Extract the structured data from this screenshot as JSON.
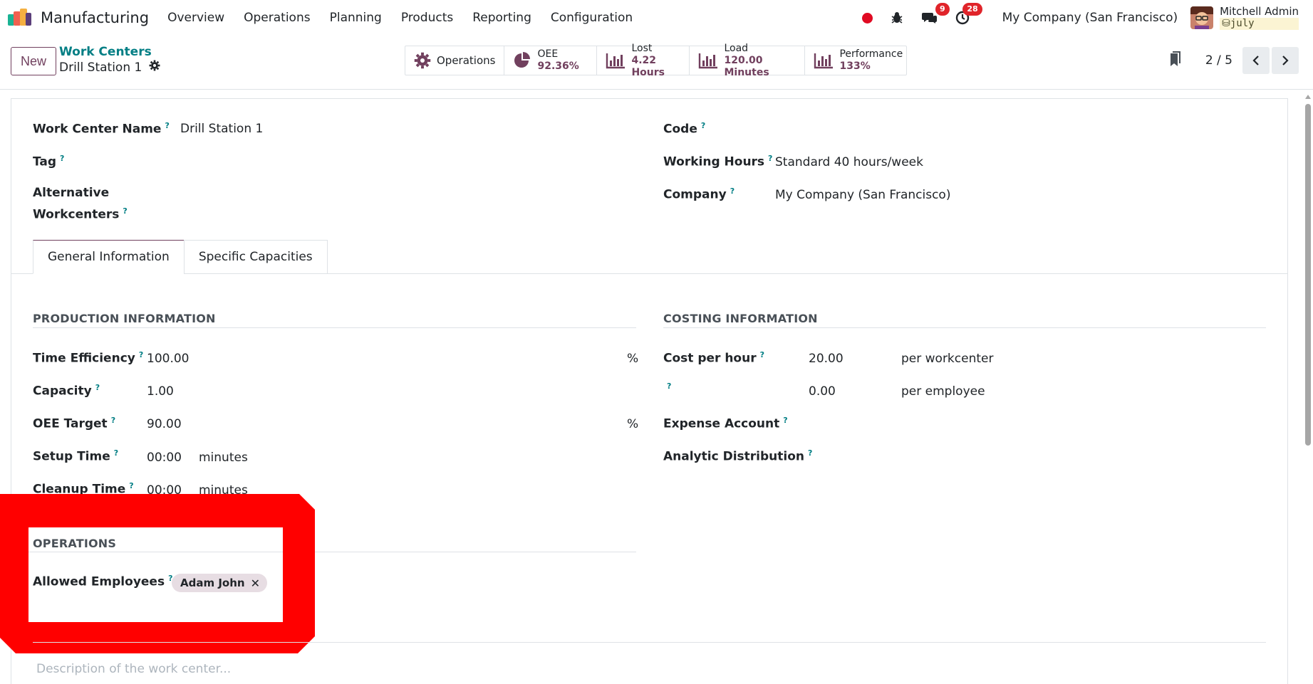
{
  "navbar": {
    "app_name": "Manufacturing",
    "menu": [
      "Overview",
      "Operations",
      "Planning",
      "Products",
      "Reporting",
      "Configuration"
    ],
    "messages_badge": "9",
    "activities_badge": "28",
    "company": "My Company (San Francisco)",
    "user_name": "Mitchell Admin",
    "database": "july"
  },
  "control": {
    "new_label": "New",
    "breadcrumb_parent": "Work Centers",
    "breadcrumb_current": "Drill Station 1",
    "pager": "2 / 5",
    "smart_buttons": {
      "operations": "Operations",
      "oee_label": "OEE",
      "oee_value": "92.36%",
      "lost_label": "Lost",
      "lost_value": "4.22 Hours",
      "load_label": "Load",
      "load_value": "120.00 Minutes",
      "performance_label": "Performance",
      "performance_value": "133%"
    }
  },
  "form": {
    "work_center_name_label": "Work Center Name",
    "work_center_name_value": "Drill Station 1",
    "tag_label": "Tag",
    "alternative_label_1": "Alternative",
    "alternative_label_2": "Workcenters",
    "code_label": "Code",
    "working_hours_label": "Working Hours",
    "working_hours_value": "Standard 40 hours/week",
    "company_label": "Company",
    "company_value": "My Company (San Francisco)",
    "help_mark": "?"
  },
  "tabs": {
    "general": "General Information",
    "capacities": "Specific Capacities"
  },
  "production": {
    "title": "PRODUCTION INFORMATION",
    "time_efficiency_label": "Time Efficiency",
    "time_efficiency_value": "100.00",
    "capacity_label": "Capacity",
    "capacity_value": "1.00",
    "oee_target_label": "OEE Target",
    "oee_target_value": "90.00",
    "setup_time_label": "Setup Time",
    "setup_time_value": "00:00",
    "cleanup_time_label": "Cleanup Time",
    "cleanup_time_value": "00:00",
    "percent_unit": "%",
    "minutes_unit": "minutes"
  },
  "costing": {
    "title": "COSTING INFORMATION",
    "cost_per_hour_label": "Cost per hour",
    "cost_per_hour_value": "20.00",
    "cost_per_hour_unit": "per workcenter",
    "employee_cost_value": "0.00",
    "employee_cost_unit": "per employee",
    "expense_account_label": "Expense Account",
    "analytic_distribution_label": "Analytic Distribution"
  },
  "operations": {
    "title": "OPERATIONS",
    "allowed_employees_label": "Allowed Employees",
    "employee_tag": "Adam John",
    "remove_mark": "✕"
  },
  "description_placeholder": "Description of the work center...",
  "colors": {
    "brand": "#71405e",
    "link": "#017e84",
    "highlight": "#ff0000"
  }
}
